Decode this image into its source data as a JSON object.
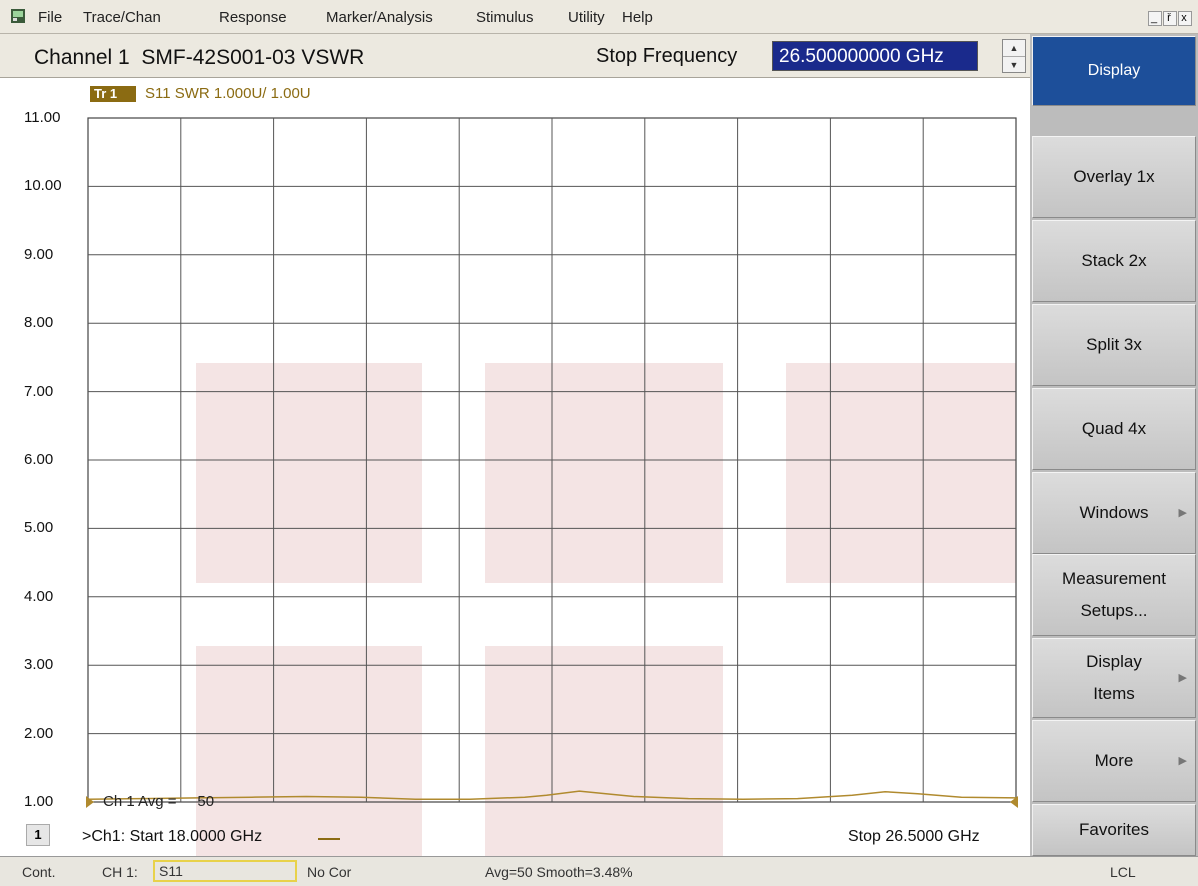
{
  "menu": [
    "File",
    "Trace/Chan",
    "Response",
    "Marker/Analysis",
    "Stimulus",
    "Utility",
    "Help"
  ],
  "window_controls": [
    "_",
    "ř",
    "x"
  ],
  "toolbar": {
    "channel_title": "Channel 1  SMF-42S001-03 VSWR",
    "stop_label": "Stop Frequency",
    "stop_value": "26.500000000 GHz"
  },
  "trace": {
    "tag": "Tr 1",
    "desc": "S11 SWR 1.000U/  1.00U",
    "avg_annotation": "Ch 1 Avg =     50"
  },
  "chart_data": {
    "type": "line",
    "ylabels": [
      "11.00",
      "10.00",
      "9.00",
      "8.00",
      "7.00",
      "6.00",
      "5.00",
      "4.00",
      "3.00",
      "2.00",
      "1.00"
    ],
    "ylim": [
      1,
      11
    ],
    "xlim": [
      18,
      26.5
    ],
    "xlabel": "",
    "ylabel": "",
    "series": [
      {
        "color": "#b08a2e",
        "x": [
          18.0,
          18.5,
          19.0,
          19.5,
          20.0,
          20.5,
          21.0,
          21.5,
          22.0,
          22.2,
          22.5,
          23.0,
          23.5,
          24.0,
          24.5,
          25.0,
          25.3,
          25.6,
          26.0,
          26.5
        ],
        "values": [
          1.04,
          1.05,
          1.06,
          1.07,
          1.08,
          1.07,
          1.04,
          1.04,
          1.07,
          1.1,
          1.16,
          1.08,
          1.05,
          1.04,
          1.05,
          1.1,
          1.15,
          1.12,
          1.07,
          1.06
        ]
      }
    ]
  },
  "footer": {
    "channel_num": "1",
    "start_label": ">Ch1: Start  18.0000 GHz",
    "stop_label": "Stop  26.5000 GHz"
  },
  "status": {
    "mode": "Cont.",
    "ch": "CH 1:",
    "param": "S11",
    "cor": "No Cor",
    "avg": "Avg=50 Smooth=3.48%",
    "lcl": "LCL"
  },
  "softkeys": [
    {
      "label": "Display",
      "label2": "",
      "active": true,
      "arrow": false
    },
    {
      "label": "Overlay 1x",
      "label2": "",
      "active": false,
      "arrow": false
    },
    {
      "label": "Stack 2x",
      "label2": "",
      "active": false,
      "arrow": false
    },
    {
      "label": "Split 3x",
      "label2": "",
      "active": false,
      "arrow": false
    },
    {
      "label": "Quad 4x",
      "label2": "",
      "active": false,
      "arrow": false
    },
    {
      "label": "Windows",
      "label2": "",
      "active": false,
      "arrow": true
    },
    {
      "label": "Measurement",
      "label2": "Setups...",
      "active": false,
      "arrow": false
    },
    {
      "label": "Display",
      "label2": "Items",
      "active": false,
      "arrow": true
    },
    {
      "label": "More",
      "label2": "",
      "active": false,
      "arrow": true
    },
    {
      "label": "Favorites",
      "label2": "",
      "active": false,
      "arrow": false
    }
  ],
  "colors": {
    "trace": "#b08a2e",
    "active_key": "#1d4f9a",
    "watermark": "#f4e4e4"
  }
}
